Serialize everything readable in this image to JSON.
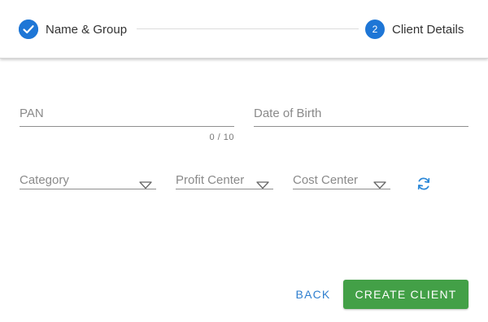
{
  "stepper": {
    "step1": {
      "label": "Name & Group",
      "state": "completed",
      "icon": "check-icon"
    },
    "step2": {
      "number": "2",
      "label": "Client Details",
      "state": "active"
    }
  },
  "form": {
    "pan": {
      "label": "PAN",
      "counter": "0 / 10"
    },
    "dob": {
      "label": "Date of Birth"
    },
    "category": {
      "label": "Category"
    },
    "profit_center": {
      "label": "Profit Center"
    },
    "cost_center": {
      "label": "Cost Center"
    },
    "refresh_icon": "refresh-icon"
  },
  "actions": {
    "back_label": "BACK",
    "create_label": "CREATE CLIENT"
  },
  "colors": {
    "accent": "#1e76d6",
    "primary_button": "#43a047",
    "link": "#2f7fcf"
  }
}
